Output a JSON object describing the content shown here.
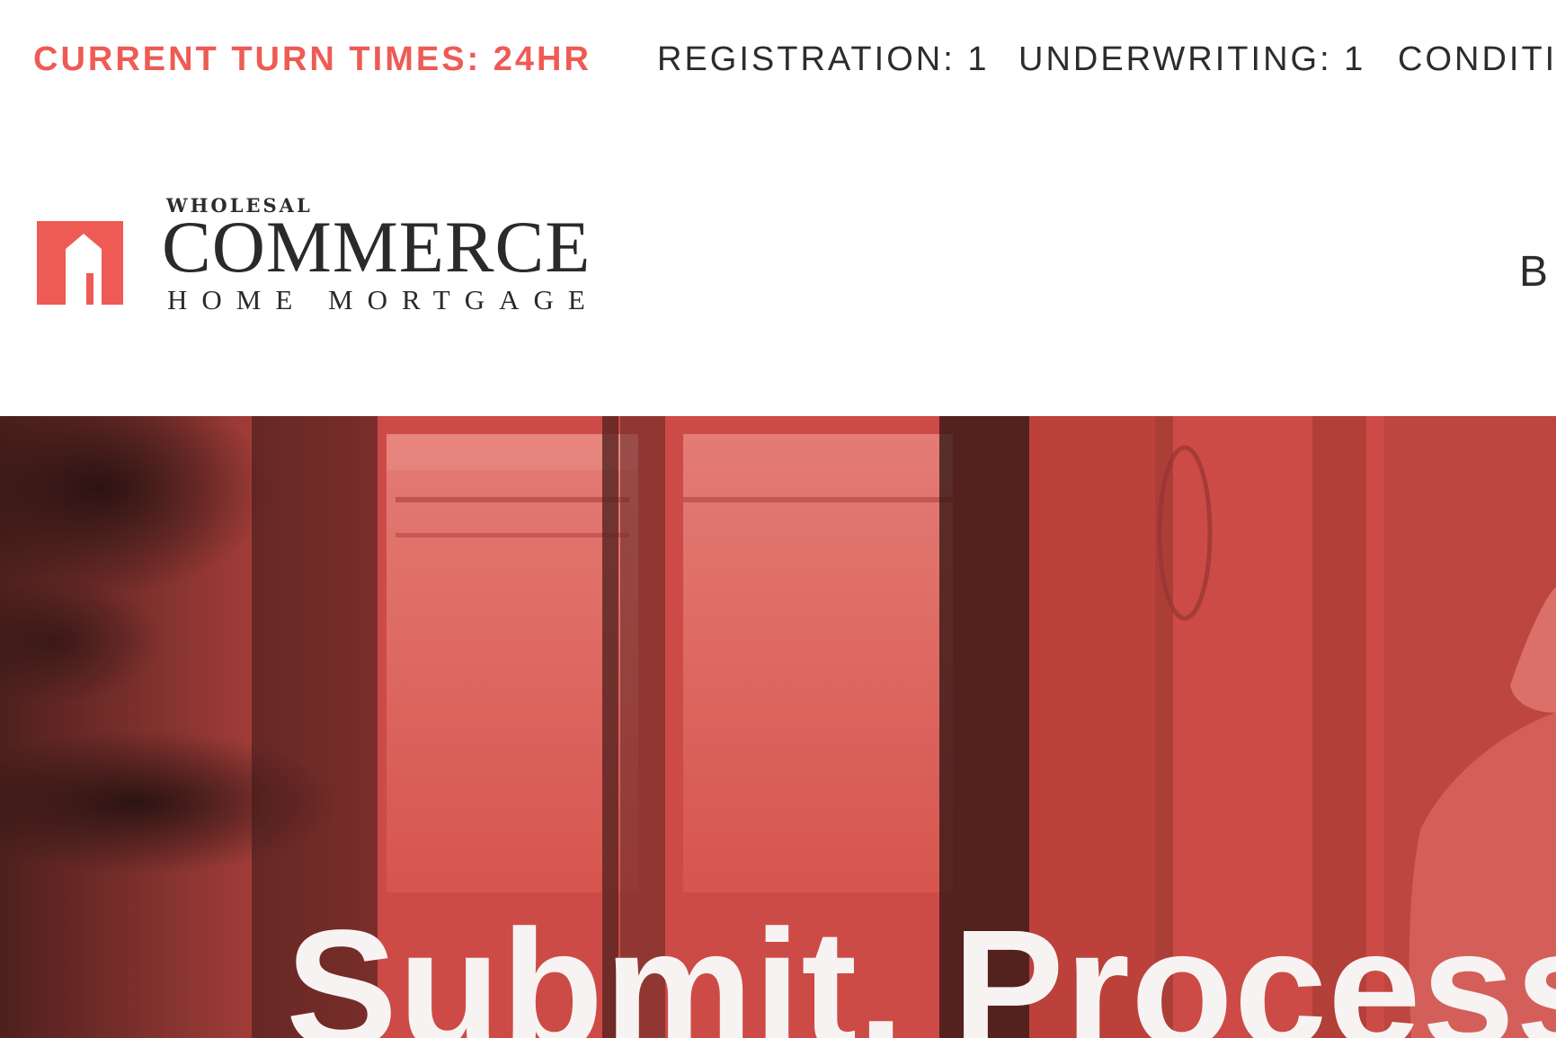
{
  "turn_times": {
    "label": "CURRENT TURN TIMES: 24HR",
    "items": [
      "REGISTRATION: 1",
      "UNDERWRITING: 1",
      "CONDITIO"
    ]
  },
  "logo": {
    "top_text": "WHOLESAL",
    "main_text": "COMMERCE",
    "sub_text": "HOME MORTGAGE"
  },
  "nav": {
    "partial_item": "B"
  },
  "hero": {
    "heading": "Submit. Process."
  },
  "colors": {
    "accent": "#ee5b55",
    "text_dark": "#2c2c2c",
    "hero_overlay": "#d9504a"
  }
}
